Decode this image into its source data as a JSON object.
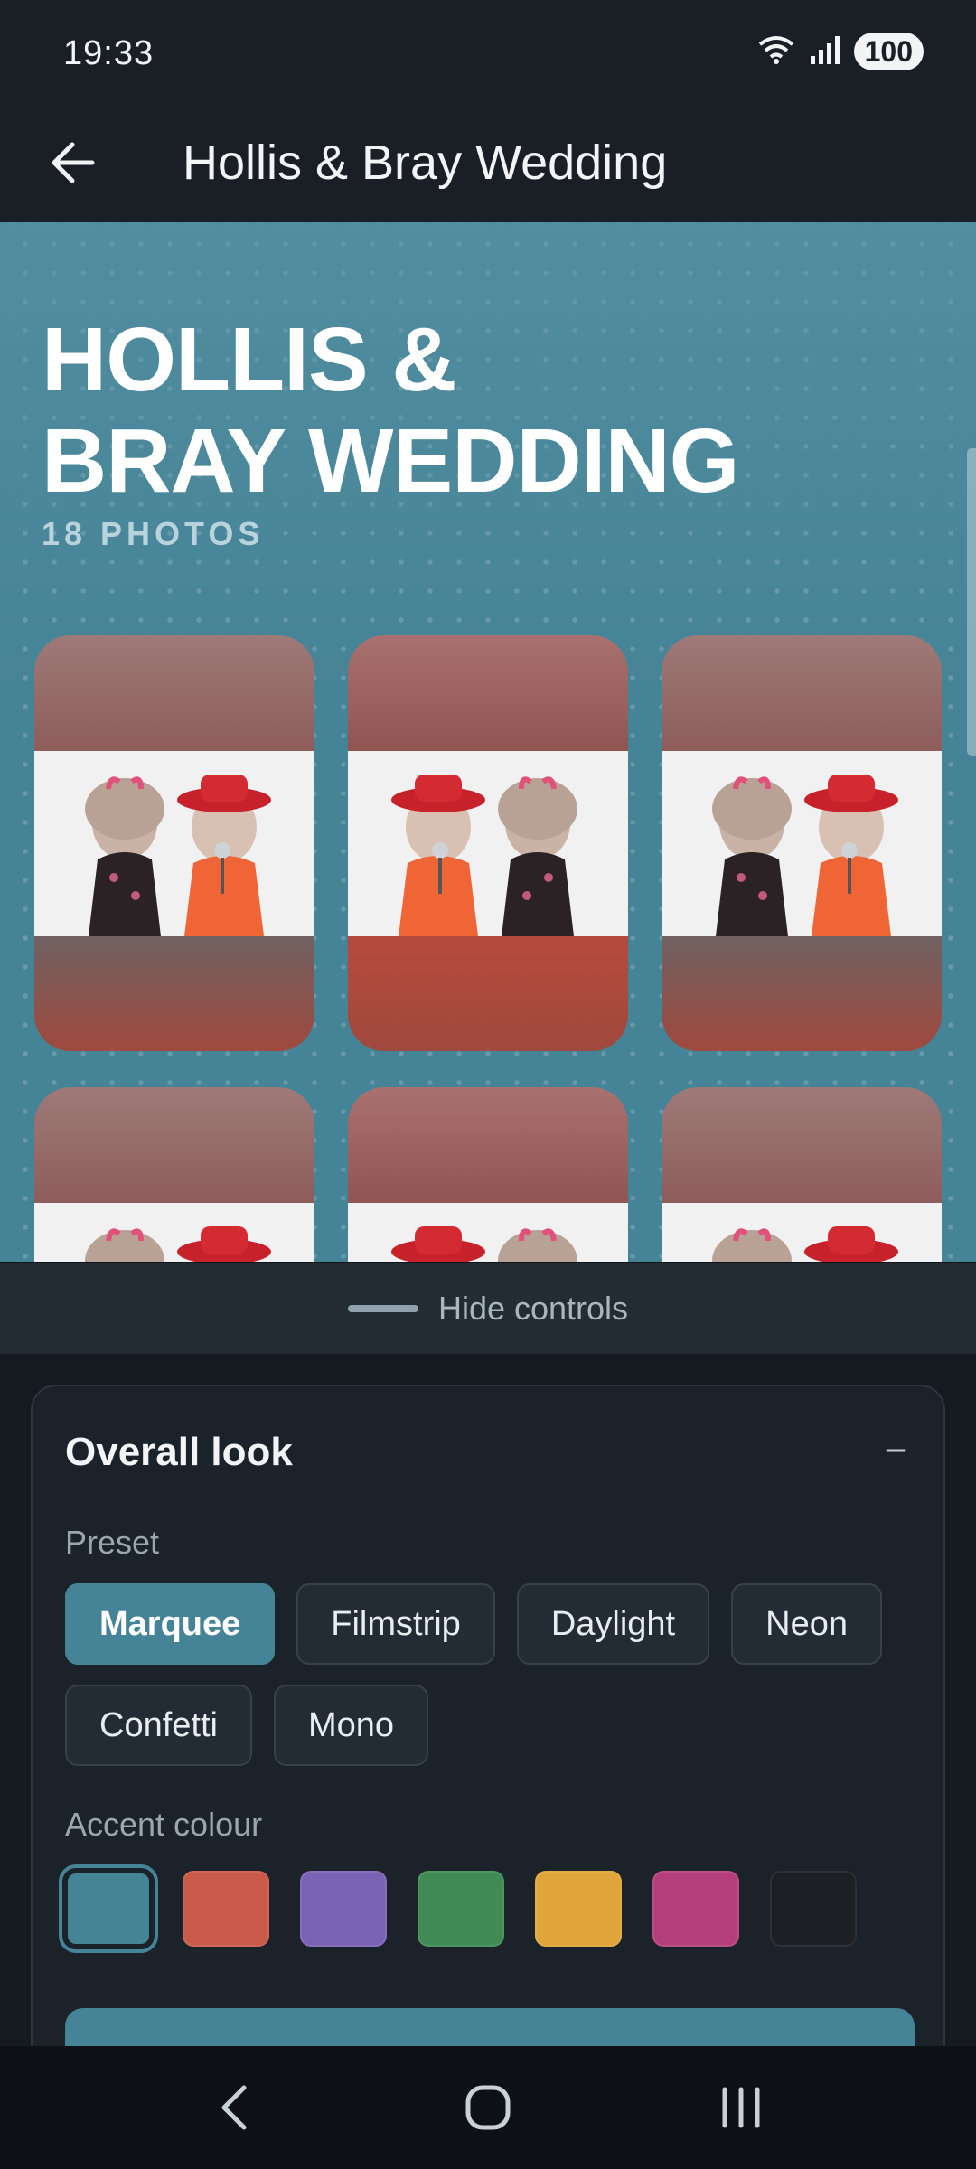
{
  "status_bar": {
    "time": "19:33",
    "battery": "100",
    "wifi_icon": "wifi-icon",
    "signal_icon": "signal-icon"
  },
  "app_bar": {
    "title": "Hollis & Bray Wedding",
    "back_icon": "arrow-back-icon"
  },
  "preview": {
    "title_line1": "HOLLIS &",
    "title_line2": "BRAY WEDDING",
    "count_label": "18 PHOTOS",
    "photos": [
      "photo-1",
      "photo-2",
      "photo-3",
      "photo-4",
      "photo-5",
      "photo-6"
    ]
  },
  "hide_controls": {
    "label": "Hide controls"
  },
  "overall_look": {
    "title": "Overall look",
    "collapse_symbol": "−",
    "preset_label": "Preset",
    "presets": [
      "Marquee",
      "Filmstrip",
      "Daylight",
      "Neon",
      "Confetti",
      "Mono"
    ],
    "selected_preset": "Marquee",
    "accent_label": "Accent colour",
    "accent_colors": [
      "#458396",
      "#c95a4a",
      "#7a63b4",
      "#3f8a55",
      "#e0a53a",
      "#b43f7a",
      "#1c1f24"
    ],
    "selected_accent": "#458396"
  },
  "nav_bar": {
    "back_icon": "nav-back-icon",
    "home_icon": "nav-home-icon",
    "recents_icon": "nav-recents-icon"
  }
}
